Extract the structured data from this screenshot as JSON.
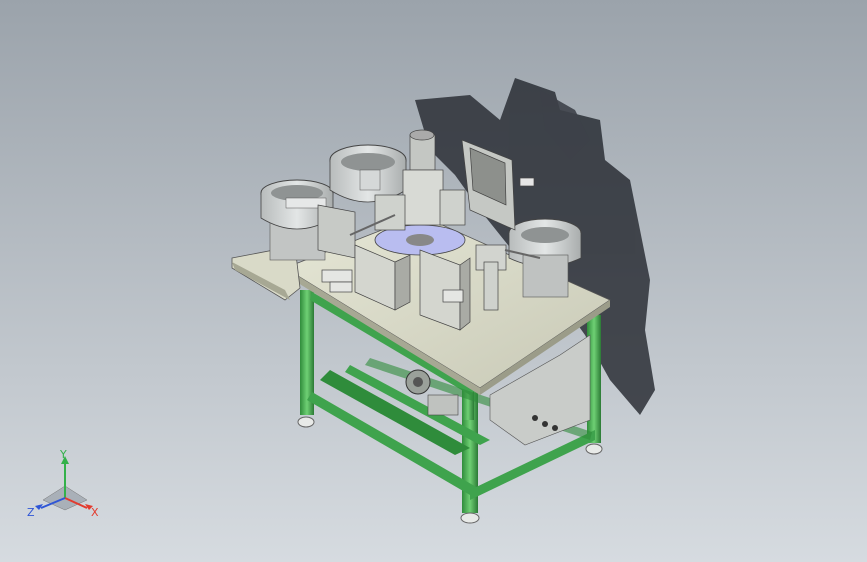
{
  "viewport": {
    "background_top": "#9ba3ab",
    "background_bottom": "#d6dbe0"
  },
  "model": {
    "frame_color": "#3fa34d",
    "plate_color": "#d9dac8",
    "metal_color": "#c9ccc9",
    "shadow_color": "#2b2f36"
  },
  "triad": {
    "x_label": "X",
    "y_label": "Y",
    "z_label": "Z",
    "x_color": "#e33b2e",
    "y_color": "#33b14a",
    "z_color": "#2f56d6"
  }
}
